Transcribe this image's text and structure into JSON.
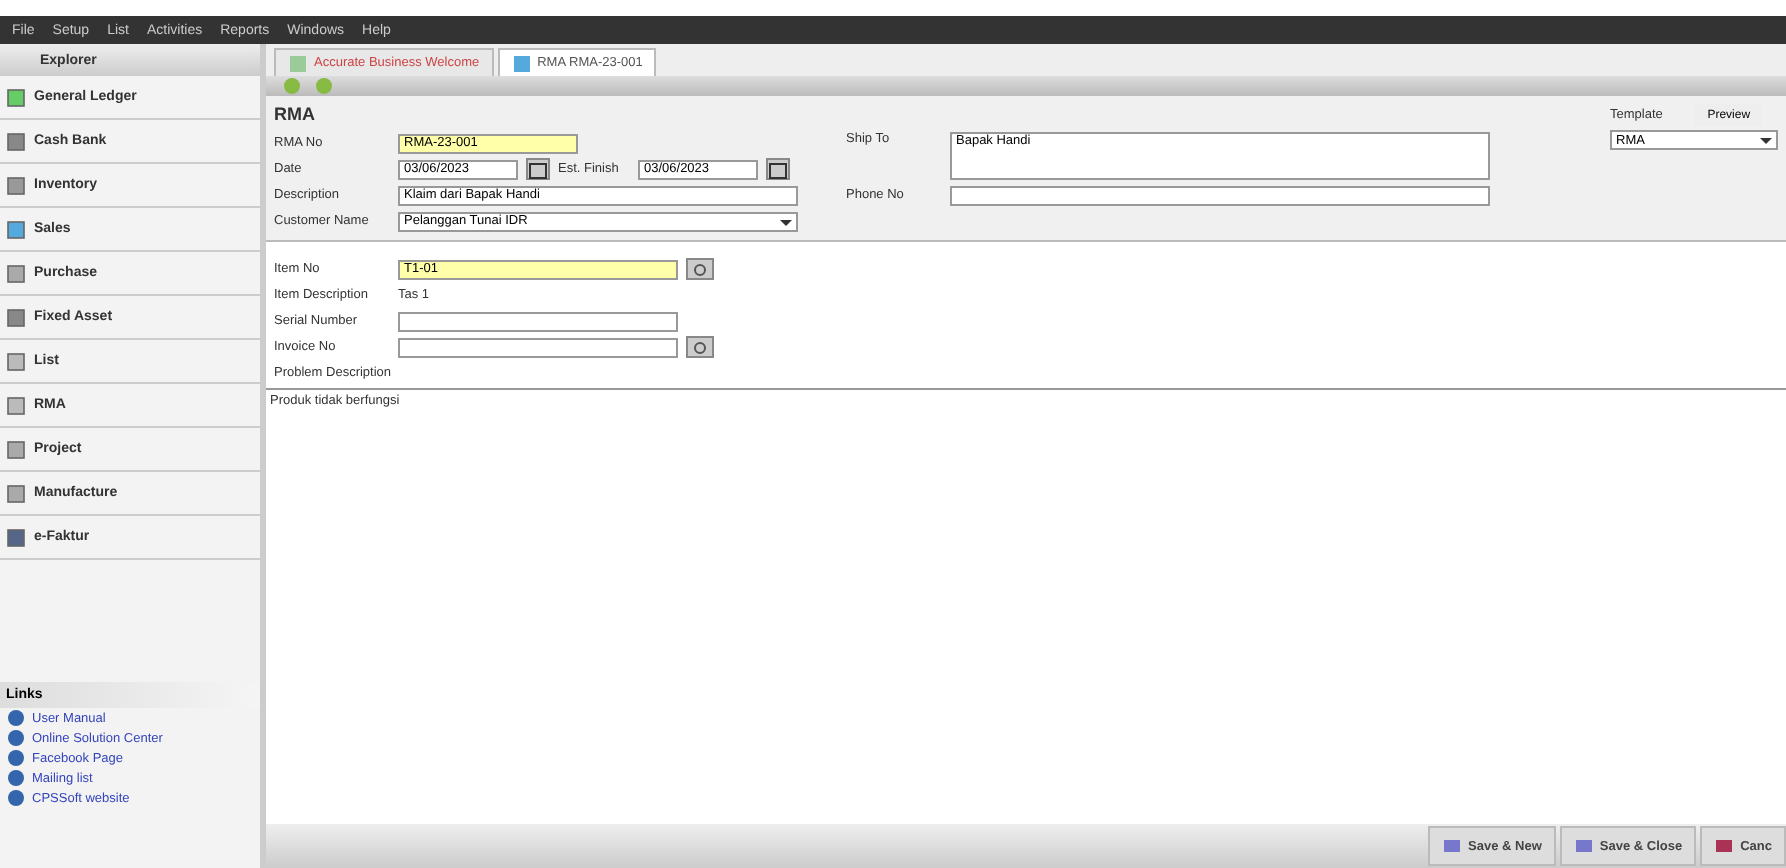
{
  "menu": [
    "File",
    "Setup",
    "List",
    "Activities",
    "Reports",
    "Windows",
    "Help"
  ],
  "tabs": [
    {
      "label": "Accurate Business Welcome",
      "selected": false
    },
    {
      "label": "RMA RMA-23-001",
      "selected": true
    }
  ],
  "sidebar": {
    "title": "Explorer",
    "items": [
      {
        "label": "General Ledger"
      },
      {
        "label": "Cash Bank"
      },
      {
        "label": "Inventory"
      },
      {
        "label": "Sales"
      },
      {
        "label": "Purchase"
      },
      {
        "label": "Fixed Asset"
      },
      {
        "label": "List"
      },
      {
        "label": "RMA"
      },
      {
        "label": "Project"
      },
      {
        "label": "Manufacture"
      },
      {
        "label": "e-Faktur"
      }
    ]
  },
  "links": {
    "title": "Links",
    "items": [
      "User Manual",
      "Online Solution Center",
      "Facebook Page",
      "Mailing list",
      "CPSSoft website"
    ]
  },
  "form": {
    "title": "RMA",
    "template_label": "Template",
    "template": "RMA",
    "preview": "Preview",
    "rma_no": {
      "label": "RMA No",
      "value": "RMA-23-001"
    },
    "date": {
      "label": "Date",
      "value": "03/06/2023"
    },
    "est_finish": {
      "label": "Est. Finish",
      "value": "03/06/2023"
    },
    "description": {
      "label": "Description",
      "value": "Klaim dari Bapak Handi"
    },
    "customer": {
      "label": "Customer Name",
      "value": "Pelanggan Tunai IDR"
    },
    "ship_to": {
      "label": "Ship To",
      "value": "Bapak Handi"
    },
    "phone": {
      "label": "Phone No"
    },
    "item_no": {
      "label": "Item No",
      "value": "T1-01"
    },
    "item_description": {
      "label": "Item Description",
      "value": "Tas 1"
    },
    "serial": {
      "label": "Serial Number"
    },
    "invoice": {
      "label": "Invoice No"
    },
    "problem": {
      "label": "Problem Description",
      "value": "Produk tidak berfungsi"
    }
  },
  "buttons": [
    "Save & New",
    "Save & Close",
    "Canc"
  ]
}
